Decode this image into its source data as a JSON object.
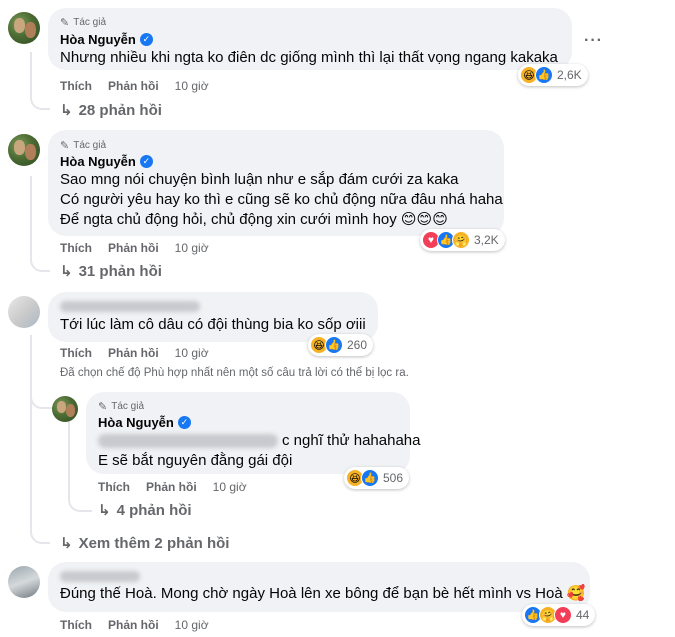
{
  "labels": {
    "author_tag": "Tác giả",
    "like": "Thích",
    "reply": "Phản hồi",
    "see_more_replies": "Xem thêm 2 phản hồi"
  },
  "comments": [
    {
      "name": "Hòa Nguyễn",
      "lines": [
        "Nhưng nhiều khi ngta ko điên dc giống mình thì lại thất vọng ngang kakaka"
      ],
      "time": "10 giờ",
      "reactions": [
        "haha",
        "like"
      ],
      "reaction_count": "2,6K",
      "replies_label": "28 phản hồi"
    },
    {
      "name": "Hòa Nguyễn",
      "lines": [
        "Sao mng nói chuyện bình luận như e sắp đám cưới za kaka",
        "Có người yêu hay ko thì e cũng sẽ ko chủ động nữa đâu nhá haha",
        "Để ngta chủ động hỏi, chủ động xin cưới mình hoy 😊😊😊"
      ],
      "time": "10 giờ",
      "reactions": [
        "love",
        "like",
        "care"
      ],
      "reaction_count": "3,2K",
      "replies_label": "31 phản hồi"
    },
    {
      "lines": [
        "Tới lúc làm cô dâu có đội thùng bia ko sốp ơiii"
      ],
      "time": "10 giờ",
      "reactions": [
        "haha",
        "like"
      ],
      "reaction_count": "260",
      "filter_note": "Đã chọn chế độ Phù hợp nhất nên một số câu trả lời có thể bị lọc ra."
    },
    {
      "name": "Hòa Nguyễn",
      "lines": [
        "c nghĩ thử hahahaha",
        "E sẽ bắt nguyên đằng gái đội"
      ],
      "time": "10 giờ",
      "reactions": [
        "haha",
        "like"
      ],
      "reaction_count": "506",
      "replies_label": "4 phản hồi"
    },
    {
      "lines": [
        "Đúng thế Hoà. Mong chờ ngày Hoà lên xe bông để bạn bè hết mình vs Hoà 🥰"
      ],
      "time": "10 giờ",
      "reactions": [
        "like",
        "care",
        "love"
      ],
      "reaction_count": "44"
    }
  ],
  "icons": {
    "verified": "verified-badge-icon",
    "pen": "pen-icon",
    "more": "more-dots-icon",
    "reply_arrow": "reply-arrow-icon"
  },
  "colors": {
    "bubble": "#f0f2f5",
    "secondary_text": "#65676b",
    "like_blue": "#1877f2",
    "love_red": "#f33e58",
    "haha_yellow": "#f7b125"
  }
}
